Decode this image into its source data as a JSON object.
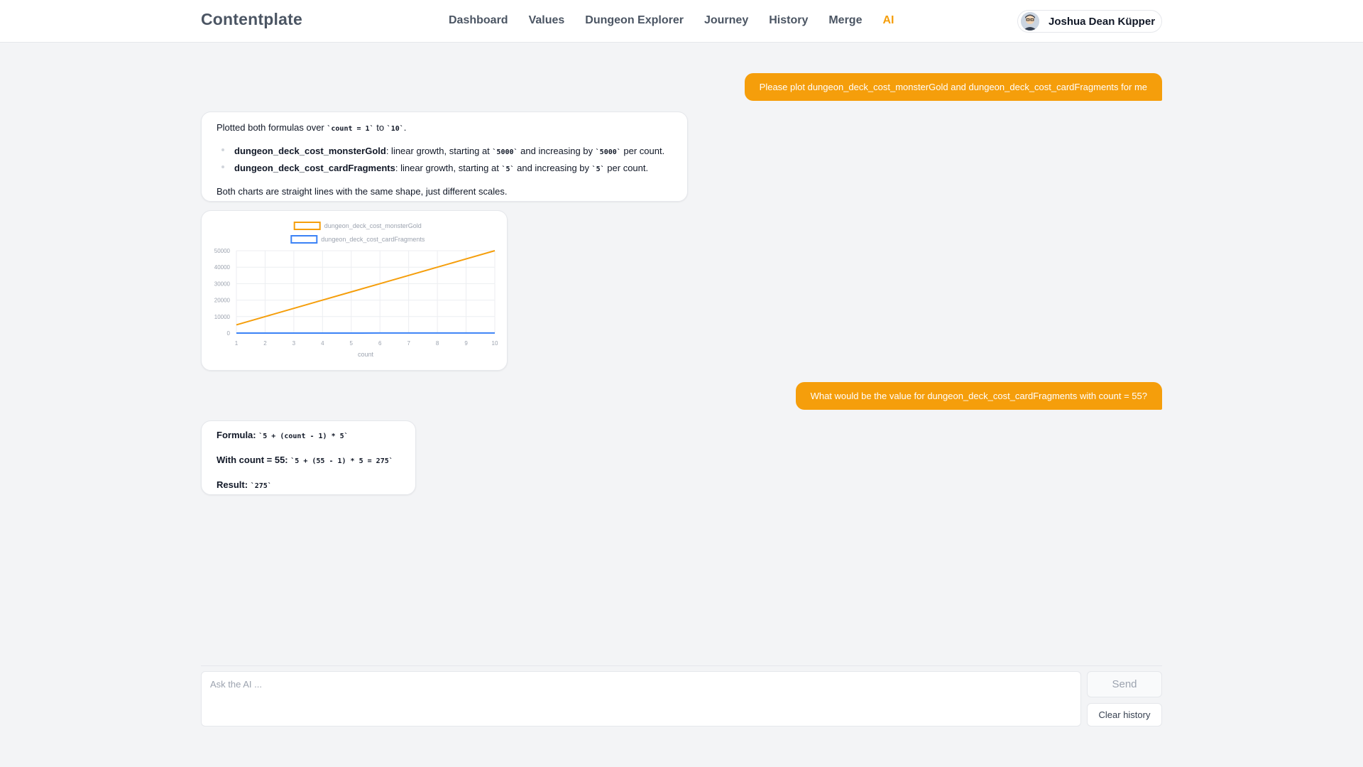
{
  "app": {
    "brand": "Contentplate"
  },
  "nav": {
    "items": [
      {
        "label": "Dashboard"
      },
      {
        "label": "Values"
      },
      {
        "label": "Dungeon Explorer"
      },
      {
        "label": "Journey"
      },
      {
        "label": "History"
      },
      {
        "label": "Merge"
      },
      {
        "label": "AI"
      }
    ],
    "active": "AI"
  },
  "user": {
    "name": "Joshua Dean Küpper"
  },
  "messages": {
    "user1": "Please plot dungeon_deck_cost_monsterGold and dungeon_deck_cost_cardFragments for me",
    "ai1": {
      "intro_pre": "Plotted both formulas over ",
      "intro_code1": "`count = 1`",
      "intro_mid": " to ",
      "intro_code2": "`10`",
      "intro_post": ".",
      "bullet1": {
        "name": "dungeon_deck_cost_monsterGold",
        "text_a": ": linear growth, starting at ",
        "code_a": "`5000`",
        "text_b": " and increasing by ",
        "code_b": "`5000`",
        "text_c": " per count."
      },
      "bullet2": {
        "name": "dungeon_deck_cost_cardFragments",
        "text_a": ": linear growth, starting at ",
        "code_a": "`5`",
        "text_b": " and increasing by ",
        "code_b": "`5`",
        "text_c": " per count."
      },
      "outro": "Both charts are straight lines with the same shape, just different scales."
    },
    "user2": "What would be the value for dungeon_deck_cost_cardFragments with count = 55?",
    "ai2": {
      "formula_label": "Formula:",
      "formula_code": "`5 + (count - 1) * 5`",
      "with_label": "With count = 55:",
      "with_code": "`5 + (55 - 1) * 5 = 275`",
      "result_label": "Result:",
      "result_code": "`275`"
    }
  },
  "chart_data": {
    "type": "line",
    "x": [
      1,
      2,
      3,
      4,
      5,
      6,
      7,
      8,
      9,
      10
    ],
    "xlabel": "count",
    "ylabel": "",
    "xlim": [
      1,
      10
    ],
    "ylim": [
      0,
      50000
    ],
    "yticks": [
      0,
      10000,
      20000,
      30000,
      40000,
      50000
    ],
    "xticks": [
      1,
      2,
      3,
      4,
      5,
      6,
      7,
      8,
      9,
      10
    ],
    "grid": true,
    "legend": "top",
    "series": [
      {
        "name": "dungeon_deck_cost_monsterGold",
        "color": "#f59e0b",
        "values": [
          5000,
          10000,
          15000,
          20000,
          25000,
          30000,
          35000,
          40000,
          45000,
          50000
        ]
      },
      {
        "name": "dungeon_deck_cost_cardFragments",
        "color": "#3b82f6",
        "values": [
          5,
          10,
          15,
          20,
          25,
          30,
          35,
          40,
          45,
          50
        ]
      }
    ]
  },
  "input": {
    "placeholder": "Ask the AI ...",
    "value": ""
  },
  "buttons": {
    "send": "Send",
    "clear": "Clear history"
  },
  "colors": {
    "accent": "#f59e0b",
    "series2": "#3b82f6"
  }
}
